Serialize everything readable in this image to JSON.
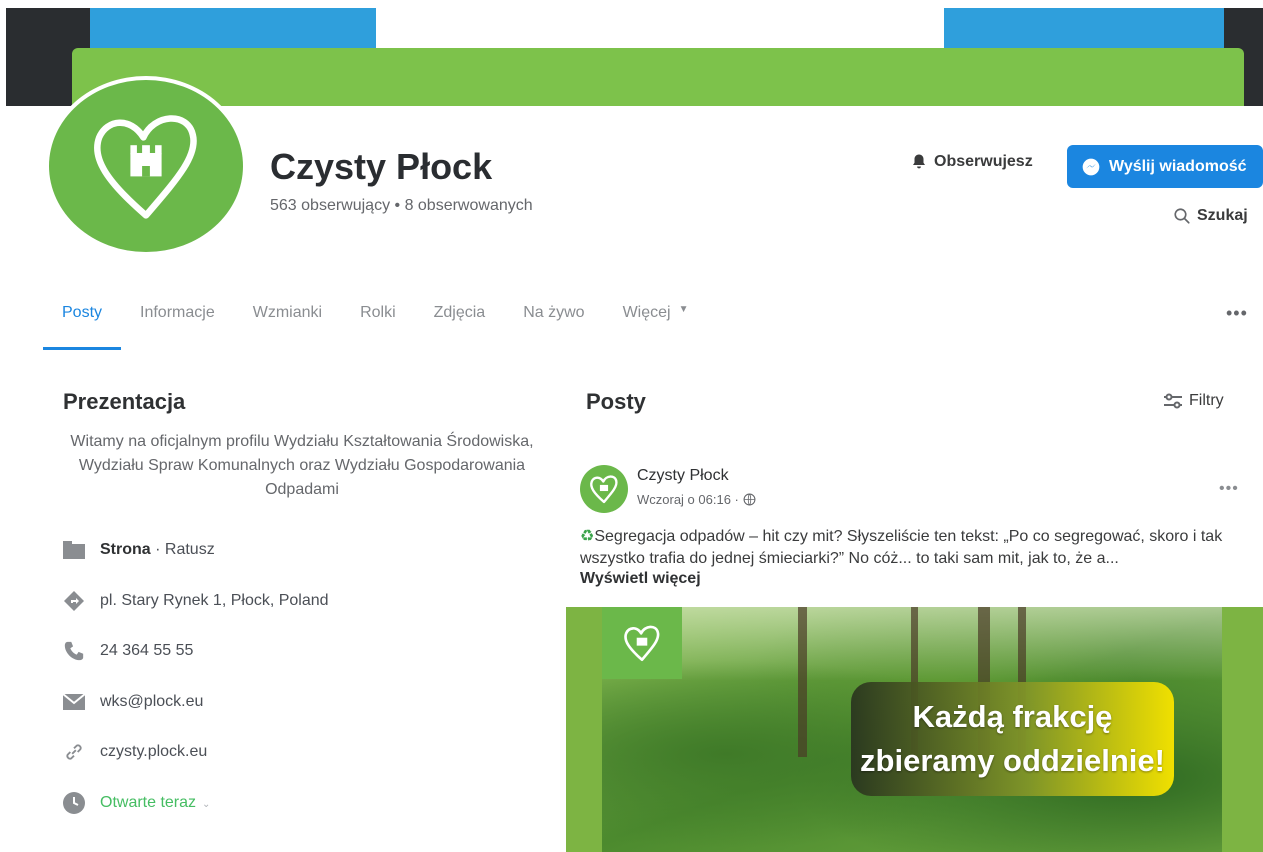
{
  "page": {
    "name": "Czysty Płock",
    "stats": "563 obserwujący • 8 obserwowanych"
  },
  "actions": {
    "follow_label": "Obserwujesz",
    "message_label": "Wyślij wiadomość",
    "search_label": "Szukaj"
  },
  "tabs": [
    {
      "label": "Posty"
    },
    {
      "label": "Informacje"
    },
    {
      "label": "Wzmianki"
    },
    {
      "label": "Rolki"
    },
    {
      "label": "Zdjęcia"
    },
    {
      "label": "Na żywo"
    },
    {
      "label": "Więcej"
    }
  ],
  "intro": {
    "title": "Prezentacja",
    "text": "Witamy na oficjalnym profilu Wydziału Kształtowania Środowiska, Wydziału Spraw Komunalnych oraz Wydziału Gospodarowania Odpadami",
    "items": {
      "type_label": "Strona",
      "type_value": "· Ratusz",
      "address": "pl. Stary Rynek 1, Płock, Poland",
      "phone": "24 364 55 55",
      "email": "wks@plock.eu",
      "website": "czysty.plock.eu",
      "hours": "Otwarte teraz"
    }
  },
  "posts": {
    "title": "Posty",
    "filters_label": "Filtry",
    "post": {
      "author": "Czysty Płock",
      "time": "Wczoraj o 06:16 ·",
      "text": "Segregacja odpadów – hit czy mit? Słyszeliście ten tekst: „Po co segregować, skoro i tak wszystko trafia do jednej śmieciarki?” No cóż... to taki sam mit, jak to, że a...",
      "see_more": "Wyświetl więcej",
      "image_line1": "Każdą frakcję",
      "image_line2": "zbieramy oddzielnie!"
    }
  },
  "colors": {
    "accent": "#1b86e0",
    "brand_green": "#6bb84a",
    "open_green": "#45bd62"
  },
  "icons": [
    "bell-icon",
    "messenger-icon",
    "search-icon",
    "more-icon",
    "filters-icon",
    "page-icon",
    "location-icon",
    "phone-icon",
    "email-icon",
    "link-icon",
    "clock-icon",
    "globe-icon",
    "recycle-icon",
    "bus-icon",
    "heart-logo-icon"
  ]
}
